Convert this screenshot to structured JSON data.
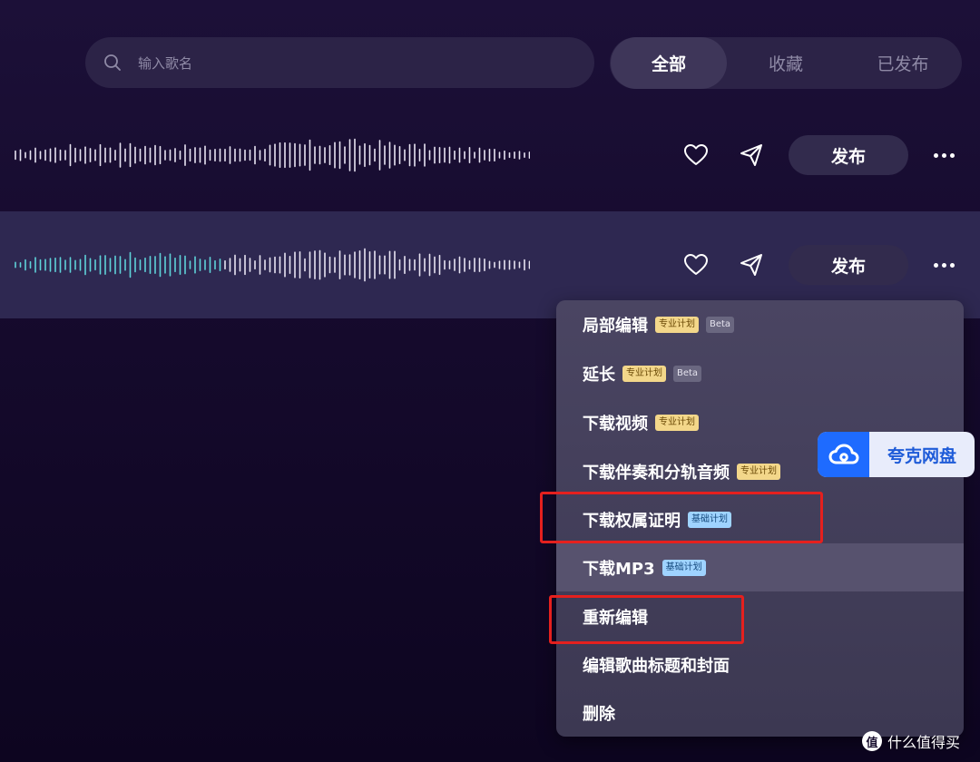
{
  "search": {
    "placeholder": "输入歌名",
    "icon": "search-icon"
  },
  "tabs": [
    {
      "label": "全部",
      "active": true
    },
    {
      "label": "收藏",
      "active": false
    },
    {
      "label": "已发布",
      "active": false
    }
  ],
  "songs": [
    {
      "publish_label": "发布",
      "selected": false,
      "played_fraction": 0
    },
    {
      "publish_label": "发布",
      "selected": true,
      "played_fraction": 0.4
    }
  ],
  "colors": {
    "background": "#1c1038",
    "wave_played": "#5fd3d9",
    "wave_unplayed": "#ffffff",
    "highlight_box": "#e5201e",
    "badge_pro": "#f3d78a",
    "badge_basic": "#9fd3ff"
  },
  "menu": {
    "items": [
      {
        "label": "局部编辑",
        "badges": [
          {
            "text": "专业计划",
            "type": "pro"
          },
          {
            "text": "Beta",
            "type": "beta"
          }
        ]
      },
      {
        "label": "延长",
        "badges": [
          {
            "text": "专业计划",
            "type": "pro"
          },
          {
            "text": "Beta",
            "type": "beta"
          }
        ]
      },
      {
        "label": "下载视频",
        "badges": [
          {
            "text": "专业计划",
            "type": "pro"
          }
        ]
      },
      {
        "label": "下载伴奏和分轨音频",
        "badges": [
          {
            "text": "专业计划",
            "type": "pro"
          }
        ]
      },
      {
        "label": "下载权属证明",
        "badges": [
          {
            "text": "基础计划",
            "type": "basic"
          }
        ],
        "highlighted": true
      },
      {
        "label": "下载MP3",
        "badges": [
          {
            "text": "基础计划",
            "type": "basic"
          }
        ],
        "hover": true
      },
      {
        "label": "重新编辑",
        "badges": [],
        "highlighted": true
      },
      {
        "label": "编辑歌曲标题和封面",
        "badges": []
      },
      {
        "label": "删除",
        "badges": []
      }
    ]
  },
  "quark": {
    "label": "夸克网盘",
    "icon": "cloud-icon"
  },
  "watermark": {
    "icon_text": "值",
    "text": "什么值得买"
  }
}
